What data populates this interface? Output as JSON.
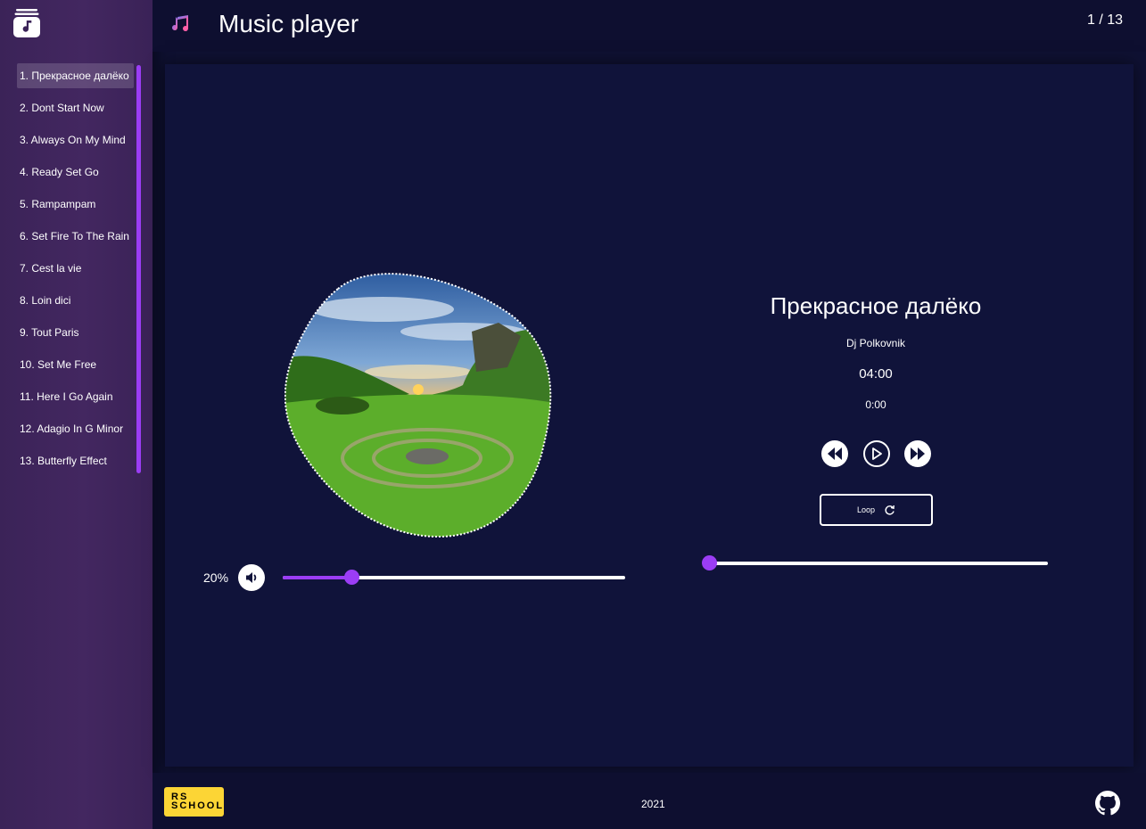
{
  "header": {
    "title": "Music player",
    "counter": "1 / 13",
    "note_icon": "music-note-icon"
  },
  "sidebar": {
    "logo_icon": "music-library-icon",
    "active_index": 0,
    "playlist": [
      "1. Прекрасное далёко",
      "2. Dont Start Now",
      "3. Always On My Mind",
      "4. Ready Set Go",
      "5. Rampampam",
      "6. Set Fire To The Rain",
      "7. Cest la vie",
      "8. Loin dici",
      "9. Tout Paris",
      "10. Set Me Free",
      "11. Here I Go Again",
      "12. Adagio In G Minor",
      "13. Butterfly Effect"
    ]
  },
  "player": {
    "title": "Прекрасное далёко",
    "artist": "Dj Polkovnik",
    "duration": "04:00",
    "current_time": "0:00",
    "progress": 0,
    "loop_label": "Loop",
    "loop_icon": "refresh-icon",
    "prev_icon": "rewind-icon",
    "play_icon": "play-icon",
    "next_icon": "fast-forward-icon"
  },
  "volume": {
    "label": "20%",
    "level": 0.2,
    "icon": "speaker-icon"
  },
  "footer": {
    "year": "2021",
    "school_logo_text": [
      "RS",
      "SCHOOL"
    ],
    "github_icon": "github-icon"
  },
  "colors": {
    "accent": "#9b3df5",
    "background": "#0f1133",
    "sidebar": "#432760",
    "school_yellow": "#fcd535"
  }
}
